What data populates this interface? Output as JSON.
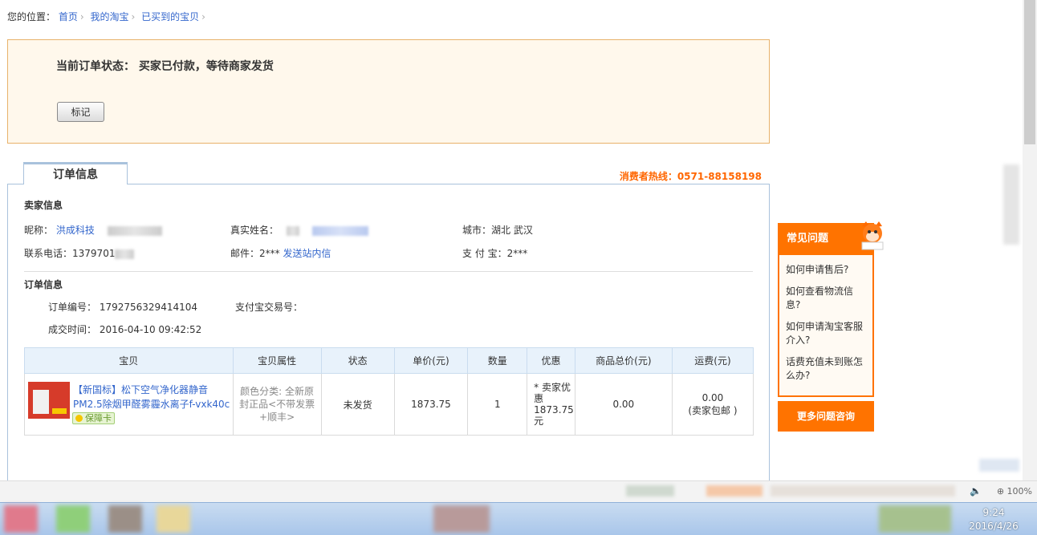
{
  "breadcrumb": {
    "label": "您的位置：",
    "items": [
      "首页",
      "我的淘宝",
      "已买到的宝贝"
    ]
  },
  "status": {
    "text": "当前订单状态：  买家已付款，等待商家发货",
    "mark_button": "标记"
  },
  "tab": {
    "label": "订单信息"
  },
  "hotline": "消费者热线：0571-88158198",
  "seller": {
    "section_title": "卖家信息",
    "nickname_label": "昵称：",
    "nickname": "洪成科技",
    "realname_label": "真实姓名：",
    "city_label": "城市：",
    "city": "湖北 武汉",
    "phone_label": "联系电话：",
    "phone": "1379701",
    "email_label": "邮件：",
    "email": "2***",
    "message_link": "发送站内信",
    "alipay_label": "支 付 宝：",
    "alipay": "2***"
  },
  "order": {
    "section_title": "订单信息",
    "number_label": "订单编号：",
    "number": "1792756329414104",
    "trade_label": "支付宝交易号：",
    "time_label": "成交时间：",
    "time": "2016-04-10 09:42:52"
  },
  "table": {
    "headers": [
      "宝贝",
      "宝贝属性",
      "状态",
      "单价(元)",
      "数量",
      "优惠",
      "商品总价(元)",
      "运费(元)"
    ],
    "row": {
      "title": "【新国标】松下空气净化器静音PM2.5除烟甲醛雾霾水离子f-vxk40c",
      "badge": "保障卡",
      "attributes": "颜色分类: 全新原封正品<不带发票+顺丰>",
      "status": "未发货",
      "unit_price": "1873.75",
      "quantity": "1",
      "discount": "* 卖家优惠 1873.75元",
      "total": "0.00",
      "shipping": "0.00",
      "shipping_note": "(卖家包邮 )"
    }
  },
  "faq": {
    "title": "常见问题",
    "items": [
      "如何申请售后?",
      "如何查看物流信息?",
      "如何申请淘宝客服介入?",
      "话费充值未到账怎么办?"
    ],
    "more": "更多问题咨询"
  },
  "statusbar": {
    "zoom": "100%"
  },
  "taskbar": {
    "time": "9:24",
    "date": "2016/4/26"
  }
}
